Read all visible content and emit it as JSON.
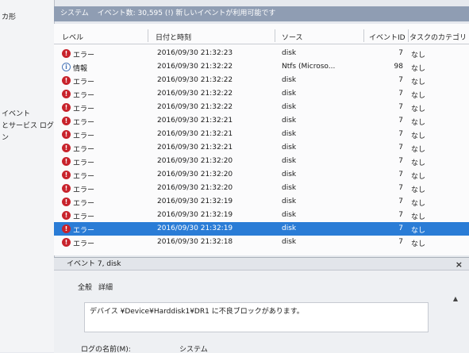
{
  "nav": {
    "items": [
      "カ形",
      "イベント",
      "とサービス ログ",
      "ン"
    ]
  },
  "header": {
    "segments": [
      "システム",
      "イベント数: 30,595 (!) 新しいイベントが利用可能です"
    ]
  },
  "grid": {
    "columns": [
      "レベル",
      "日付と時刻",
      "ソース",
      "イベントID",
      "タスクのカテゴリ"
    ],
    "rows": [
      {
        "type": "error",
        "level": "エラー",
        "date": "2016/09/30 21:32:23",
        "source": "disk",
        "id": "7",
        "task": "なし"
      },
      {
        "type": "info",
        "level": "情報",
        "date": "2016/09/30 21:32:22",
        "source": "Ntfs (Microso...",
        "id": "98",
        "task": "なし"
      },
      {
        "type": "error",
        "level": "エラー",
        "date": "2016/09/30 21:32:22",
        "source": "disk",
        "id": "7",
        "task": "なし"
      },
      {
        "type": "error",
        "level": "エラー",
        "date": "2016/09/30 21:32:22",
        "source": "disk",
        "id": "7",
        "task": "なし"
      },
      {
        "type": "error",
        "level": "エラー",
        "date": "2016/09/30 21:32:22",
        "source": "disk",
        "id": "7",
        "task": "なし"
      },
      {
        "type": "error",
        "level": "エラー",
        "date": "2016/09/30 21:32:21",
        "source": "disk",
        "id": "7",
        "task": "なし"
      },
      {
        "type": "error",
        "level": "エラー",
        "date": "2016/09/30 21:32:21",
        "source": "disk",
        "id": "7",
        "task": "なし"
      },
      {
        "type": "error",
        "level": "エラー",
        "date": "2016/09/30 21:32:21",
        "source": "disk",
        "id": "7",
        "task": "なし"
      },
      {
        "type": "error",
        "level": "エラー",
        "date": "2016/09/30 21:32:20",
        "source": "disk",
        "id": "7",
        "task": "なし"
      },
      {
        "type": "error",
        "level": "エラー",
        "date": "2016/09/30 21:32:20",
        "source": "disk",
        "id": "7",
        "task": "なし"
      },
      {
        "type": "error",
        "level": "エラー",
        "date": "2016/09/30 21:32:20",
        "source": "disk",
        "id": "7",
        "task": "なし"
      },
      {
        "type": "error",
        "level": "エラー",
        "date": "2016/09/30 21:32:19",
        "source": "disk",
        "id": "7",
        "task": "なし"
      },
      {
        "type": "error",
        "level": "エラー",
        "date": "2016/09/30 21:32:19",
        "source": "disk",
        "id": "7",
        "task": "なし"
      },
      {
        "type": "error",
        "level": "エラー",
        "date": "2016/09/30 21:32:19",
        "source": "disk",
        "id": "7",
        "task": "なし",
        "selected": true
      },
      {
        "type": "error",
        "level": "エラー",
        "date": "2016/09/30 21:32:18",
        "source": "disk",
        "id": "7",
        "task": "なし"
      }
    ]
  },
  "detail": {
    "title": "イベント 7, disk",
    "close_label": "×",
    "tabs": [
      "全般",
      "詳細"
    ],
    "description": "デバイス ¥Device¥Harddisk1¥DR1 に不良ブロックがあります。",
    "log_name_label": "ログの名前(M):",
    "log_name_value": "システム",
    "scroll_glyph": "▲"
  },
  "colors": {
    "error_badge": "#c8232c",
    "info_badge": "#4b77b9",
    "selection": "#2a7cd6",
    "header_bar": "#8f9db3"
  }
}
